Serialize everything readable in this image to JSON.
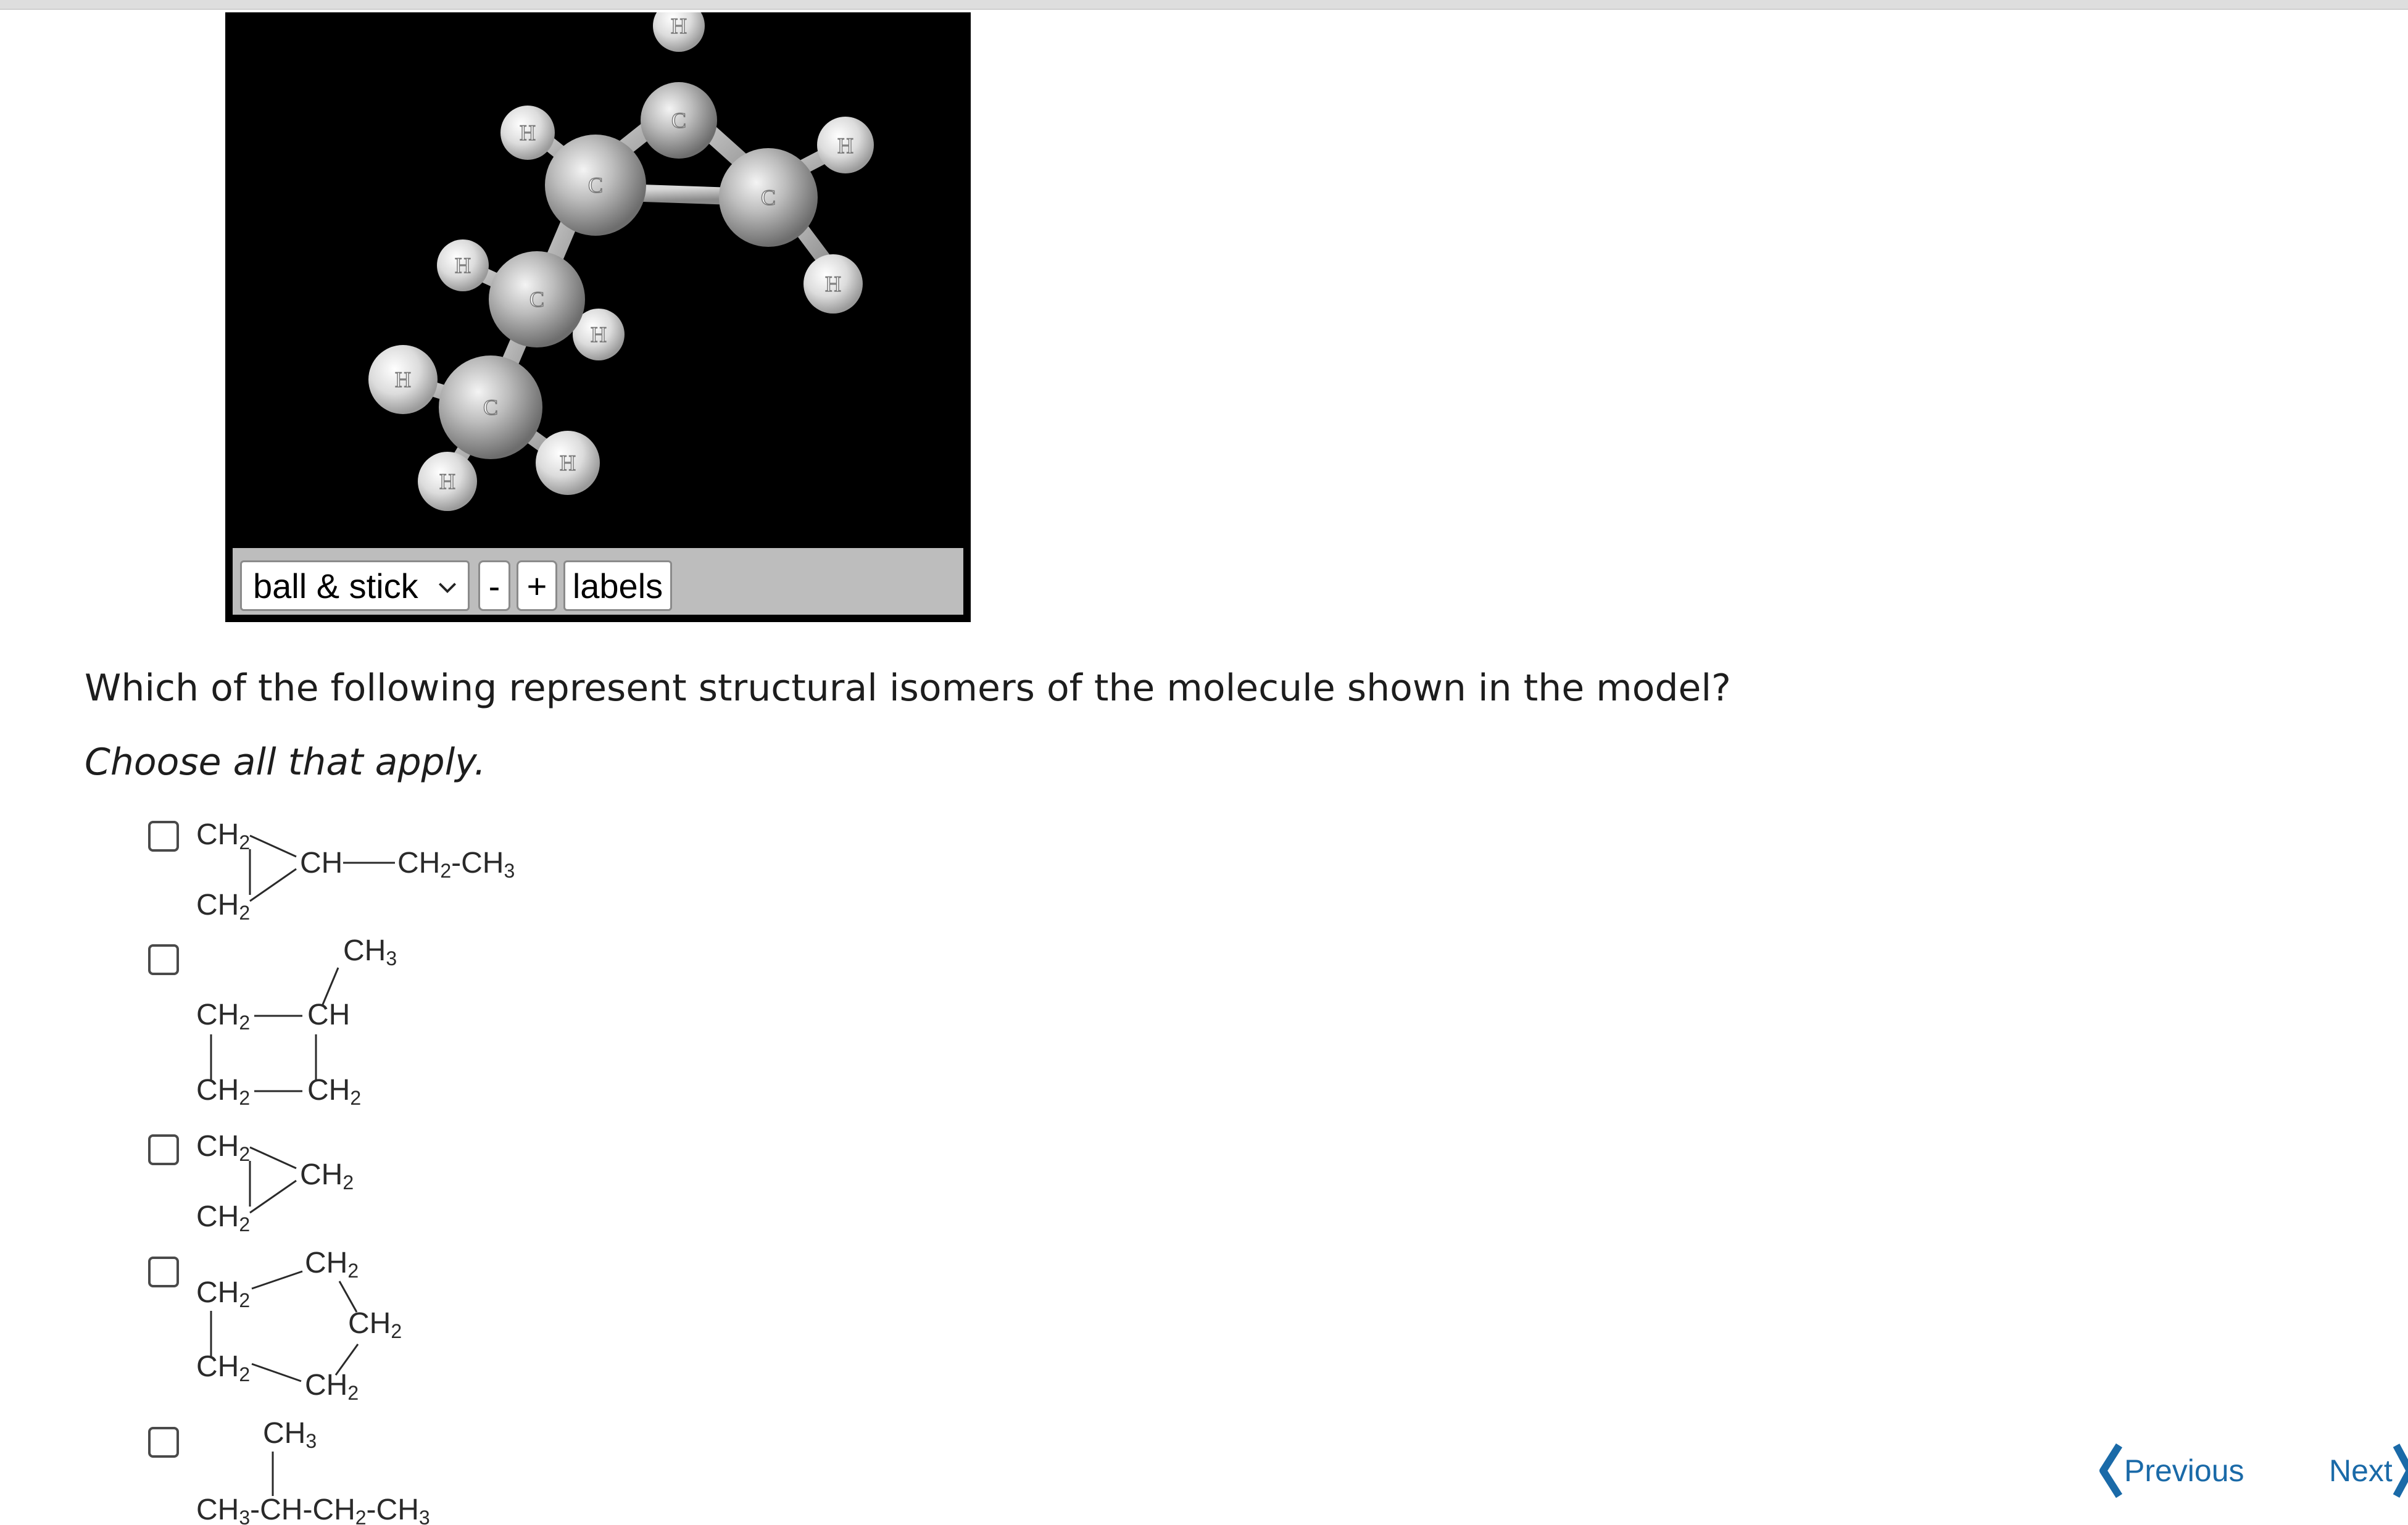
{
  "viewer": {
    "atom_labels": {
      "carbon": "C",
      "hydrogen": "H"
    },
    "controls": {
      "display_mode": "ball & stick",
      "zoom_out_label": "-",
      "zoom_in_label": "+",
      "labels_button": "labels"
    }
  },
  "question": {
    "prompt": "Which of the following represent structural isomers of the molecule shown in the model?",
    "instruction": "Choose all that apply."
  },
  "options": [
    {
      "checked": false,
      "formula_parts": {
        "a": "CH",
        "b": "2",
        "c": "CH",
        "d": "2",
        "e": "CH",
        "f": "CH",
        "g": "2",
        "h": "-CH",
        "i": "3"
      }
    },
    {
      "checked": false,
      "formula_parts": {
        "top": "CH",
        "top_sub": "3",
        "a": "CH",
        "a_sub": "2",
        "b": "CH",
        "c": "CH",
        "c_sub": "2",
        "d": "CH",
        "d_sub": "2"
      }
    },
    {
      "checked": false,
      "formula_parts": {
        "a": "CH",
        "a_sub": "2",
        "b": "CH",
        "b_sub": "2",
        "c": "CH",
        "c_sub": "2"
      }
    },
    {
      "checked": false,
      "formula_parts": {
        "top": "CH",
        "top_sub": "2",
        "a": "CH",
        "a_sub": "2",
        "right": "CH",
        "right_sub": "2",
        "b": "CH",
        "b_sub": "2",
        "bottom": "CH",
        "bottom_sub": "2"
      }
    },
    {
      "checked": false,
      "formula_parts": {
        "top": "CH",
        "top_sub": "3",
        "p1": "CH",
        "p1_sub": "3",
        "p2": "-CH-CH",
        "p2_sub": "2",
        "p3": "-CH",
        "p3_sub": "3"
      }
    }
  ],
  "navigation": {
    "previous_label": "Previous",
    "next_label": "Next"
  }
}
